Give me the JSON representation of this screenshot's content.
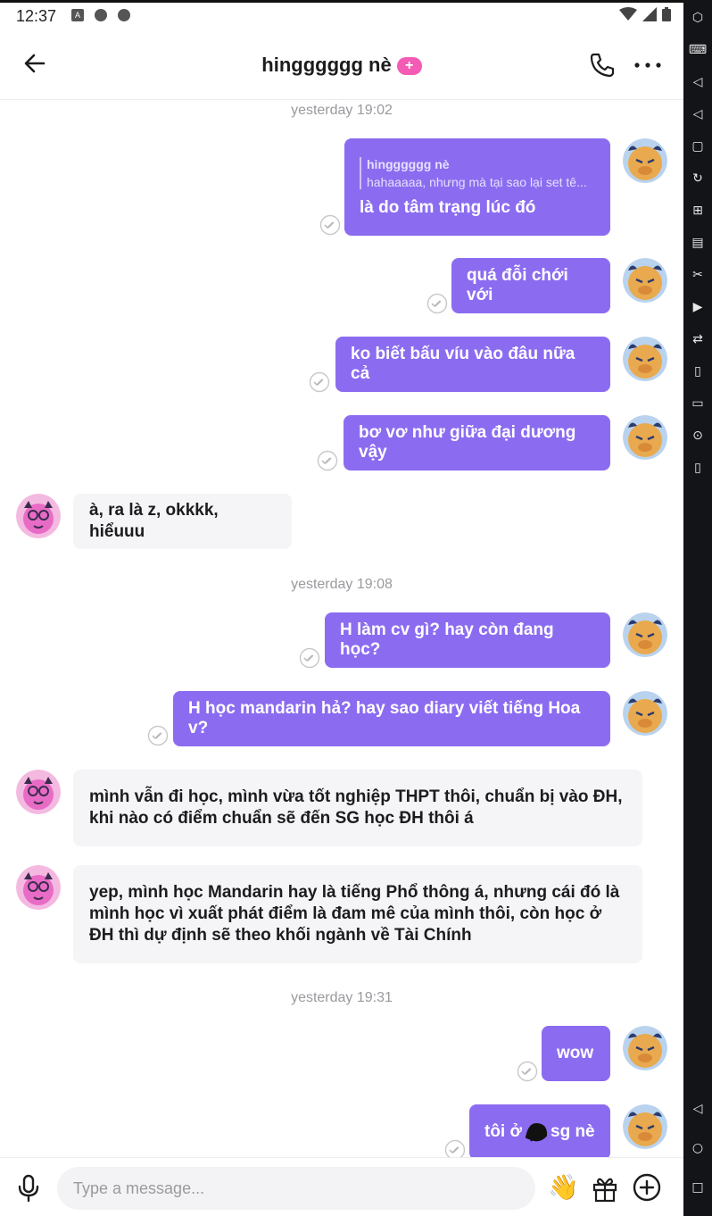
{
  "status_bar": {
    "time": "12:37"
  },
  "header": {
    "title": "hingggggg nè",
    "badge": "+"
  },
  "timestamps": [
    "yesterday 19:02",
    "yesterday 19:08",
    "yesterday 19:31"
  ],
  "messages": [
    {
      "dir": "out",
      "quote_name": "hingggggg nè",
      "quote_text": "hahaaaaa, nhưng mà tại sao lại set tê...",
      "text": "là do tâm trạng lúc đó"
    },
    {
      "dir": "out",
      "text": "quá đỗi chới với"
    },
    {
      "dir": "out",
      "text": "ko biết bấu víu vào đâu nữa cả"
    },
    {
      "dir": "out",
      "text": "bơ vơ như giữa đại dương vậy"
    },
    {
      "dir": "in",
      "text": "à, ra là z, okkkk, hiểuuu"
    },
    {
      "dir": "out",
      "text": "H làm cv gì? hay còn đang học?"
    },
    {
      "dir": "out",
      "text": "H học mandarin hả? hay sao diary viết tiếng Hoa v?"
    },
    {
      "dir": "in",
      "text": "mình vẫn đi học, mình vừa tốt nghiệp THPT thôi, chuẩn bị vào ĐH, khi nào có điểm chuẩn sẽ đến SG học ĐH thôi á"
    },
    {
      "dir": "in",
      "text": "yep, mình học Mandarin hay là tiếng Phổ thông á, nhưng cái đó là mình học vì xuất phát điểm là đam mê của mình thôi, còn học ở ĐH thì dự định sẽ theo khối ngành về Tài Chính"
    },
    {
      "dir": "out",
      "text": "wow"
    },
    {
      "dir": "out",
      "text": "tôi ở",
      "text_after": "sg nè"
    }
  ],
  "composer": {
    "placeholder": "Type a message..."
  },
  "colors": {
    "accent": "#8b6cf0",
    "badge": "#f45bb4",
    "incoming_bg": "#f5f5f7"
  },
  "icons": [
    "back-arrow-icon",
    "phone-icon",
    "more-icon",
    "read-check-icon",
    "mic-icon",
    "wave-hand-icon",
    "gift-icon",
    "add-circle-icon"
  ]
}
